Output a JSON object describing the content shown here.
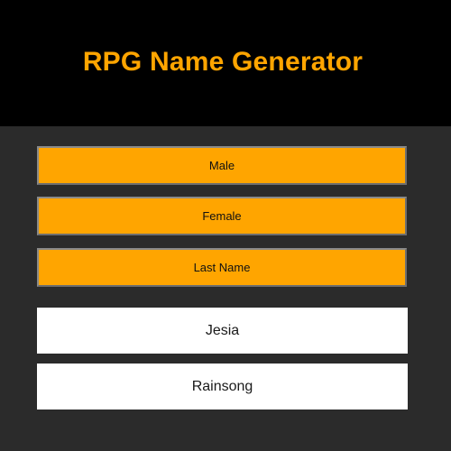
{
  "header": {
    "title": "RPG Name Generator"
  },
  "buttons": {
    "male_label": "Male",
    "female_label": "Female",
    "last_name_label": "Last Name"
  },
  "output": {
    "first_name": "Jesia",
    "last_name": "Rainsong"
  },
  "colors": {
    "accent": "#FFA500",
    "header_background": "#000000",
    "page_background": "#2B2B2B",
    "output_background": "#FFFFFF"
  }
}
